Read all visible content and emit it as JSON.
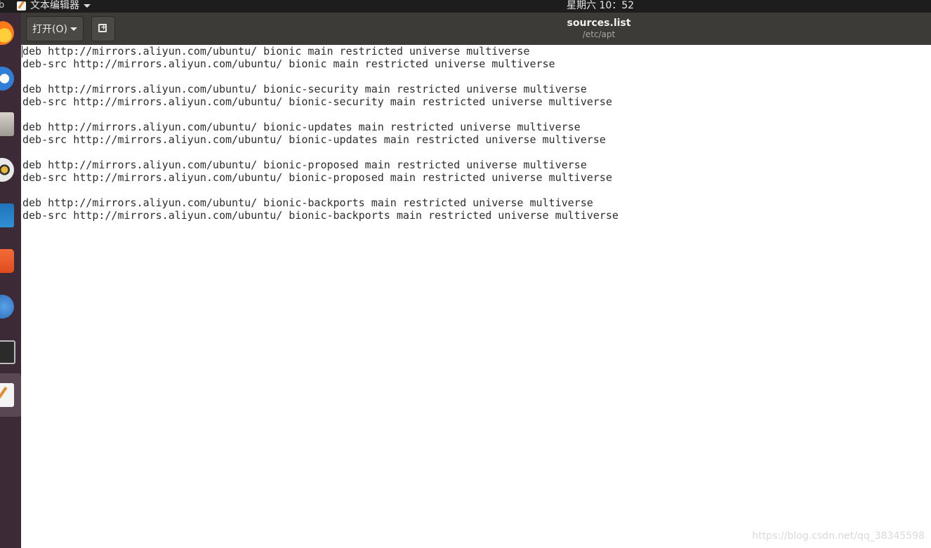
{
  "top_panel": {
    "edge_glyph": "b",
    "app_name": "文本编辑器",
    "clock": "星期六 10：52"
  },
  "dock": {
    "items": [
      {
        "name": "firefox",
        "icon": "firefox-icon"
      },
      {
        "name": "thunderbird",
        "icon": "thunderbird-icon"
      },
      {
        "name": "files",
        "icon": "files-icon"
      },
      {
        "name": "rhythmbox",
        "icon": "rhythmbox-icon"
      },
      {
        "name": "libreoffice-writer",
        "icon": "writer-icon"
      },
      {
        "name": "ubuntu-software",
        "icon": "software-icon"
      },
      {
        "name": "help",
        "icon": "help-icon"
      },
      {
        "name": "terminal",
        "icon": "terminal-icon"
      },
      {
        "name": "text-editor",
        "icon": "text-editor-icon",
        "active": true
      }
    ]
  },
  "header": {
    "open_label": "打开(O)",
    "title": "sources.list",
    "subtitle": "/etc/apt"
  },
  "editor": {
    "lines": [
      "deb http://mirrors.aliyun.com/ubuntu/ bionic main restricted universe multiverse",
      "deb-src http://mirrors.aliyun.com/ubuntu/ bionic main restricted universe multiverse",
      "",
      "deb http://mirrors.aliyun.com/ubuntu/ bionic-security main restricted universe multiverse",
      "deb-src http://mirrors.aliyun.com/ubuntu/ bionic-security main restricted universe multiverse",
      "",
      "deb http://mirrors.aliyun.com/ubuntu/ bionic-updates main restricted universe multiverse",
      "deb-src http://mirrors.aliyun.com/ubuntu/ bionic-updates main restricted universe multiverse",
      "",
      "deb http://mirrors.aliyun.com/ubuntu/ bionic-proposed main restricted universe multiverse",
      "deb-src http://mirrors.aliyun.com/ubuntu/ bionic-proposed main restricted universe multiverse",
      "",
      "deb http://mirrors.aliyun.com/ubuntu/ bionic-backports main restricted universe multiverse",
      "deb-src http://mirrors.aliyun.com/ubuntu/ bionic-backports main restricted universe multiverse"
    ]
  },
  "watermark": "https://blog.csdn.net/qq_38345598",
  "colors": {
    "panel_bg": "#1d1d1d",
    "dock_bg": "#3d2a37",
    "header_bg": "#3c3b37",
    "editor_bg": "#ffffff"
  }
}
